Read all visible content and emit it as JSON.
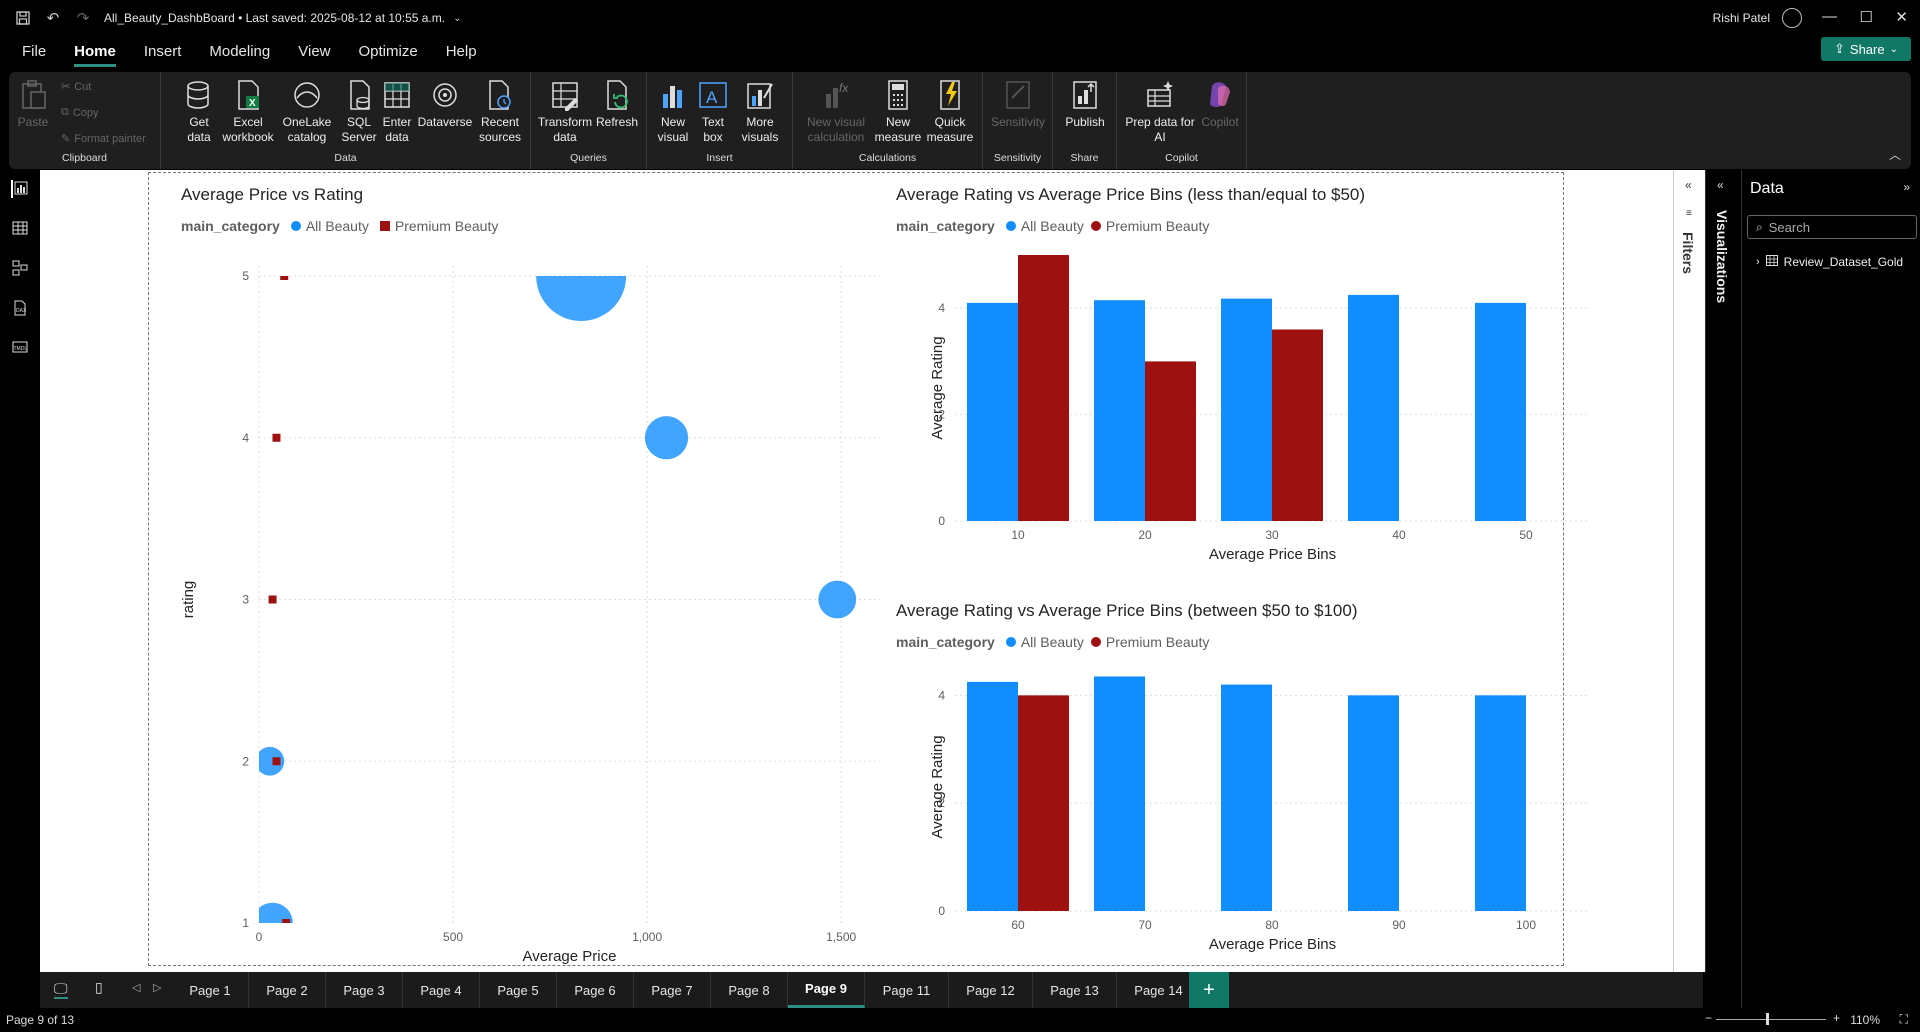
{
  "titlebar": {
    "doc_title": "All_Beauty_DashbBoard • Last saved: 2025-08-12 at 10:55 a.m.",
    "user_name": "Rishi Patel",
    "share_label": "Share"
  },
  "menu": [
    "File",
    "Home",
    "Insert",
    "Modeling",
    "View",
    "Optimize",
    "Help"
  ],
  "ribbon": {
    "clipboard": {
      "paste": "Paste",
      "cut": "Cut",
      "copy": "Copy",
      "format_painter": "Format painter",
      "label": "Clipboard"
    },
    "data": {
      "get_data_1": "Get",
      "get_data_2": "data",
      "excel_1": "Excel",
      "excel_2": "workbook",
      "onelake_1": "OneLake",
      "onelake_2": "catalog",
      "sql_1": "SQL",
      "sql_2": "Server",
      "enter_1": "Enter",
      "enter_2": "data",
      "dataverse": "Dataverse",
      "recent_1": "Recent",
      "recent_2": "sources",
      "label": "Data"
    },
    "queries": {
      "transform_1": "Transform",
      "transform_2": "data",
      "refresh": "Refresh",
      "label": "Queries"
    },
    "insert": {
      "newvis_1": "New",
      "newvis_2": "visual",
      "textbox_1": "Text",
      "textbox_2": "box",
      "more_1": "More",
      "more_2": "visuals",
      "label": "Insert"
    },
    "calculations": {
      "newcalc_1": "New visual",
      "newcalc_2": "calculation",
      "newmeas_1": "New",
      "newmeas_2": "measure",
      "quick_1": "Quick",
      "quick_2": "measure",
      "label": "Calculations"
    },
    "sensitivity": {
      "btn": "Sensitivity",
      "label": "Sensitivity"
    },
    "share": {
      "publish": "Publish",
      "label": "Share"
    },
    "copilot": {
      "prep_1": "Prep data for",
      "prep_2": "AI",
      "copilot": "Copilot",
      "label": "Copilot"
    }
  },
  "legend": {
    "field": "main_category",
    "all_beauty": "All Beauty",
    "premium_beauty": "Premium Beauty"
  },
  "colors": {
    "all_beauty": "#118dff",
    "premium_beauty": "#9e1111"
  },
  "chart_data": [
    {
      "type": "scatter",
      "title": "Average Price vs Rating",
      "xlabel": "Average Price",
      "ylabel": "rating",
      "xlim": [
        0,
        1600
      ],
      "ylim": [
        1,
        5
      ],
      "xticks": [
        "0",
        "500",
        "1,000",
        "1,500"
      ],
      "yticks": [
        "1",
        "2",
        "3",
        "4",
        "5"
      ],
      "series": [
        {
          "name": "All Beauty",
          "points": [
            [
              830,
              5,
              1.0
            ],
            [
              1050,
              4,
              0.48
            ],
            [
              1490,
              3,
              0.42
            ],
            [
              28,
              2,
              0.32
            ],
            [
              35,
              1,
              0.45
            ]
          ]
        },
        {
          "name": "Premium Beauty",
          "points": [
            [
              65,
              5
            ],
            [
              45,
              4
            ],
            [
              35,
              3
            ],
            [
              45,
              2
            ],
            [
              70,
              1
            ]
          ]
        }
      ]
    },
    {
      "type": "bar",
      "title": "Average Rating vs Average Price Bins (less than/equal to $50)",
      "xlabel": "Average Price Bins",
      "ylabel": "Average Rating",
      "ylim": [
        0,
        5
      ],
      "yticks": [
        "0",
        "2",
        "4"
      ],
      "categories": [
        "10",
        "20",
        "30",
        "40",
        "50"
      ],
      "series": [
        {
          "name": "All Beauty",
          "values": [
            4.1,
            4.15,
            4.18,
            4.25,
            4.1
          ]
        },
        {
          "name": "Premium Beauty",
          "values": [
            5.0,
            3.0,
            3.6,
            null,
            null
          ]
        }
      ]
    },
    {
      "type": "bar",
      "title": "Average Rating vs Average Price Bins (between $50 to $100)",
      "xlabel": "Average Price Bins",
      "ylabel": "Average Rating",
      "ylim": [
        0,
        4.6
      ],
      "yticks": [
        "0",
        "2",
        "4"
      ],
      "categories": [
        "60",
        "70",
        "80",
        "90",
        "100"
      ],
      "series": [
        {
          "name": "All Beauty",
          "values": [
            4.25,
            4.35,
            4.2,
            4.0,
            4.0
          ]
        },
        {
          "name": "Premium Beauty",
          "values": [
            4.0,
            null,
            null,
            null,
            null
          ]
        }
      ]
    }
  ],
  "filters_label": "Filters",
  "visualizations_label": "Visualizations",
  "data_pane": {
    "title": "Data",
    "search_placeholder": "Search",
    "table": "Review_Dataset_Gold"
  },
  "pages": [
    "Page 1",
    "Page 2",
    "Page 3",
    "Page 4",
    "Page 5",
    "Page 6",
    "Page 7",
    "Page 8",
    "Page 9",
    "Page 11",
    "Page 12",
    "Page 13",
    "Page 14"
  ],
  "active_page": "Page 9",
  "status": {
    "page_info": "Page 9 of 13",
    "zoom": "110%"
  }
}
